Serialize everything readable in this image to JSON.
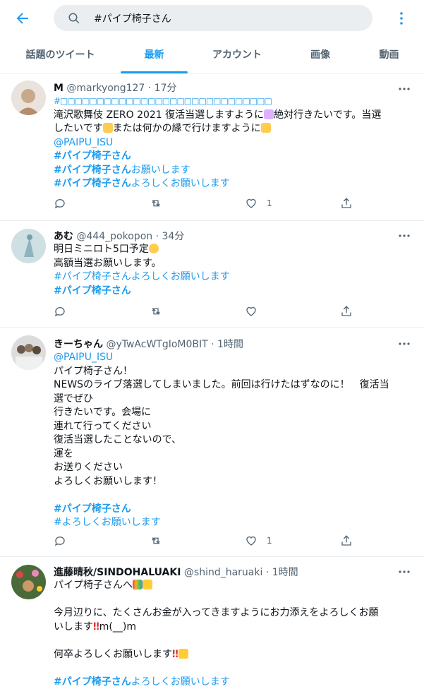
{
  "search": {
    "query": "#パイプ椅子さん"
  },
  "tabs": [
    {
      "label": "話題のツイート"
    },
    {
      "label": "最新"
    },
    {
      "label": "アカウント"
    },
    {
      "label": "画像"
    },
    {
      "label": "動画"
    }
  ],
  "tweets": [
    {
      "name": "M",
      "handle": "@markyong127",
      "time": "· 17分",
      "lines": [
        "#□□□□□□□□□□□□□□□□□□□□□□□□□□□□□",
        "滝沢歌舞伎 ZERO 2021 復活当選しますように",
        "絶対行きたいです。当選",
        "したいです",
        "または何かの縁で行けますように",
        "@PAIPU_ISU",
        "#パイプ椅子さん",
        "#パイプ椅子さん",
        "お願いします",
        "#パイプ椅子さん",
        "よろしくお願いします"
      ],
      "likes": "1"
    },
    {
      "name": "あむ",
      "handle": "@444_pokopon",
      "time": "· 34分",
      "lines": [
        "明日ミニロト5口予定",
        "高額当選お願いします。",
        "#パイプ椅子さんよろしくお願いします",
        "#パイプ椅子さん"
      ],
      "likes": ""
    },
    {
      "name": "きーちゃん",
      "handle": "@yTwAcWTgIoM0BIT",
      "time": "· 1時間",
      "lines": [
        "@PAIPU_ISU",
        "パイプ椅子さん！",
        "NEWSのライブ落選してしまいました。前回は行けたはずなのに！　復活当",
        "選でぜひ",
        "行きたいです。会場に",
        "連れて行ってください",
        "復活当選したことないので、",
        "運を",
        "お送りください",
        "よろしくお願いします！",
        "#パイプ椅子さん",
        "#よろしくお願いします"
      ],
      "likes": "1"
    },
    {
      "name": "進藤晴秋/SINDOHALUAKI",
      "handle": "@shind_haruaki",
      "time": "· 1時間",
      "lines": [
        "パイプ椅子さんへ",
        "今月辺りに、たくさんお金が入ってきますようにお力添えをよろしくお願",
        "いします",
        "m(__)m",
        "何卒よろしくお願いします",
        "#パイプ椅子さん",
        "よろしくお願いします"
      ]
    }
  ],
  "colors": {
    "accent": "#1d9bf0",
    "text": "#0f1419",
    "muted": "#536471",
    "border": "#ebeef0"
  }
}
